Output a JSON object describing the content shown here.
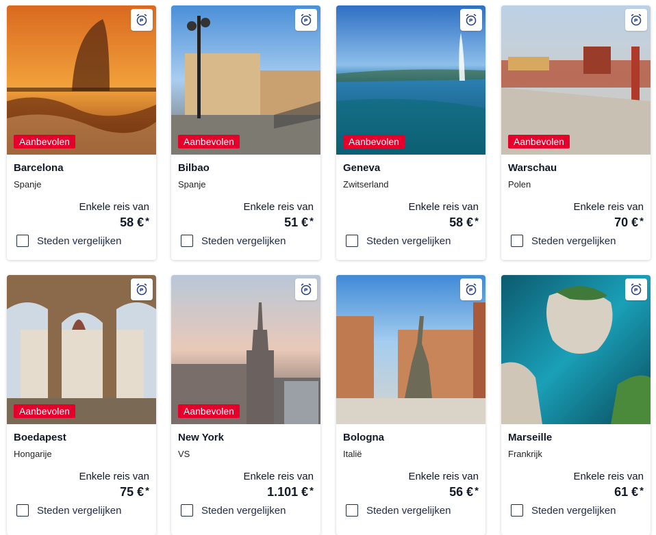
{
  "colors": {
    "badge": "#e4002b",
    "text": "#111827",
    "link": "#1f2a44"
  },
  "cards": [
    {
      "city": "Barcelona",
      "country": "Spanje",
      "from_label": "Enkele reis van",
      "price": "58 €",
      "price_mark": "*",
      "badge": "Aanbevolen",
      "compare_label": "Steden vergelijken",
      "alarm_icon": "alarm-clock-icon"
    },
    {
      "city": "Bilbao",
      "country": "Spanje",
      "from_label": "Enkele reis van",
      "price": "51 €",
      "price_mark": "*",
      "badge": "Aanbevolen",
      "compare_label": "Steden vergelijken",
      "alarm_icon": "alarm-clock-icon"
    },
    {
      "city": "Geneva",
      "country": "Zwitserland",
      "from_label": "Enkele reis van",
      "price": "58 €",
      "price_mark": "*",
      "badge": "Aanbevolen",
      "compare_label": "Steden vergelijken",
      "alarm_icon": "alarm-clock-icon"
    },
    {
      "city": "Warschau",
      "country": "Polen",
      "from_label": "Enkele reis van",
      "price": "70 €",
      "price_mark": "*",
      "badge": "Aanbevolen",
      "compare_label": "Steden vergelijken",
      "alarm_icon": "alarm-clock-icon"
    },
    {
      "city": "Boedapest",
      "country": "Hongarije",
      "from_label": "Enkele reis van",
      "price": "75 €",
      "price_mark": "*",
      "badge": "Aanbevolen",
      "compare_label": "Steden vergelijken",
      "alarm_icon": "alarm-clock-icon"
    },
    {
      "city": "New York",
      "country": "VS",
      "from_label": "Enkele reis van",
      "price": "1.101 €",
      "price_mark": "*",
      "badge": "Aanbevolen",
      "compare_label": "Steden vergelijken",
      "alarm_icon": "alarm-clock-icon"
    },
    {
      "city": "Bologna",
      "country": "Italië",
      "from_label": "Enkele reis van",
      "price": "56 €",
      "price_mark": "*",
      "badge": "",
      "compare_label": "Steden vergelijken",
      "alarm_icon": "alarm-clock-icon"
    },
    {
      "city": "Marseille",
      "country": "Frankrijk",
      "from_label": "Enkele reis van",
      "price": "61 €",
      "price_mark": "*",
      "badge": "",
      "compare_label": "Steden vergelijken",
      "alarm_icon": "alarm-clock-icon"
    }
  ]
}
